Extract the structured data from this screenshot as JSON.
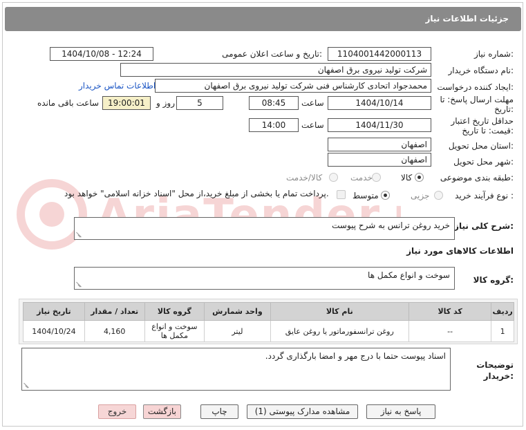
{
  "header": {
    "title": "جزئیات اطلاعات نیاز"
  },
  "fields": {
    "need_number_label": "شماره نیاز:",
    "need_number": "1104001442000113",
    "announce_label": "تاریخ و ساعت اعلان عمومی:",
    "announce_value": "1404/10/08 - 12:24",
    "buyer_org_label": "نام دستگاه خریدار:",
    "buyer_org": "شرکت تولید نیروی برق اصفهان",
    "creator_label": "ایجاد کننده درخواست:",
    "creator": "محمدجواد اتحادی کارشناس فنی شرکت تولید نیروی برق اصفهان",
    "contact_link": "اطلاعات تماس خریدار",
    "reply_deadline_label_1": "مهلت ارسال پاسخ: تا",
    "reply_deadline_label_2": "تاریخ:",
    "reply_date": "1404/10/14",
    "time_label": "ساعت",
    "reply_time": "08:45",
    "days": "5",
    "days_label": "روز و",
    "remaining_time": "19:00:01",
    "remaining_label": "ساعت باقی مانده",
    "price_validity_label_1": "حداقل تاریخ اعتبار",
    "price_validity_label_2": "قیمت: تا تاریخ:",
    "price_date": "1404/11/30",
    "price_time": "14:00",
    "delivery_province_label": "استان محل تحویل:",
    "delivery_province": "اصفهان",
    "delivery_city_label": "شهر محل تحویل:",
    "delivery_city": "اصفهان",
    "category_label": "طبقه بندی موضوعی:",
    "category_options": [
      "کالا",
      "خدمت",
      "کالا/خدمت"
    ],
    "category_selected": "کالا",
    "purchase_type_label": "نوع فرآیند خرید :",
    "purchase_options": [
      "جزیی",
      "متوسط"
    ],
    "purchase_selected": "متوسط",
    "payment_note": "پرداخت تمام یا بخشی از مبلغ خرید،از محل \"اسناد خزانه اسلامی\" خواهد بود."
  },
  "general_desc": {
    "label": "شرح کلی نیاز:",
    "value": "خرید روغن ترانس به شرح پیوست"
  },
  "goods_section": {
    "title": "اطلاعات کالاهای مورد نیاز",
    "group_label": "گروه کالا:",
    "group_value": "سوخت و انواع مکمل ها"
  },
  "table": {
    "headers": [
      "ردیف",
      "کد کالا",
      "نام کالا",
      "واحد شمارش",
      "گروه کالا",
      "تعداد / مقدار",
      "تاریخ نیاز"
    ],
    "rows": [
      {
        "row": "1",
        "code": "--",
        "name": "روغن ترانسفورماتور یا روغن عایق",
        "unit": "لیتر",
        "group": "سوخت و انواع مکمل ها",
        "qty": "4,160",
        "date": "1404/10/24"
      }
    ]
  },
  "buyer_notes": {
    "label_1": "توضیحات",
    "label_2": "خریدار:",
    "value": "اسناد پیوست حتما با درج مهر و امضا بارگذاری گردد."
  },
  "buttons": {
    "reply": "پاسخ به نیاز",
    "attachments": "مشاهده مدارک پیوستی (1)",
    "print": "چاپ",
    "back": "بازگشت",
    "exit": "خروج"
  },
  "watermark_text": "AriaTender.neT"
}
